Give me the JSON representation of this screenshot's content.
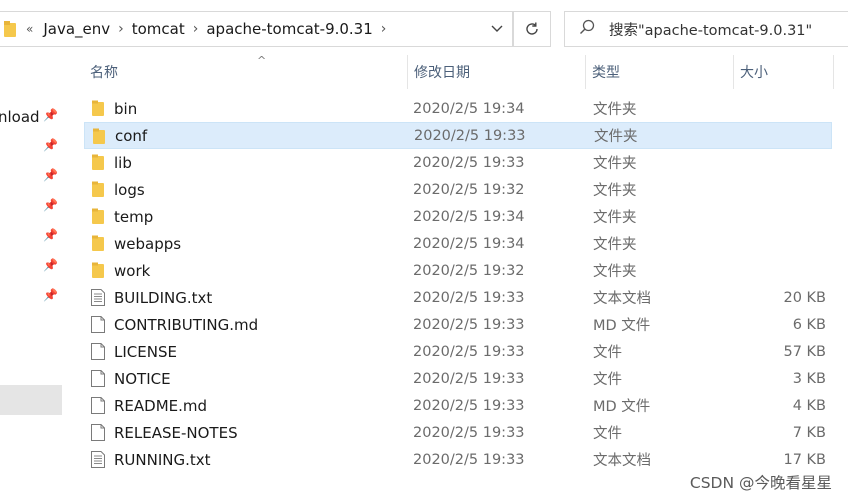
{
  "address": {
    "overflow": "«",
    "crumbs": [
      "Java_env",
      "tomcat",
      "apache-tomcat-9.0.31"
    ]
  },
  "search": {
    "placeholder": "搜索\"apache-tomcat-9.0.31\""
  },
  "nav": {
    "items": [
      {
        "label": "nload"
      },
      {
        "label": ""
      },
      {
        "label": ""
      },
      {
        "label": ""
      },
      {
        "label": ""
      },
      {
        "label": ""
      },
      {
        "label": ""
      }
    ]
  },
  "columns": {
    "name": "名称",
    "date": "修改日期",
    "type": "类型",
    "size": "大小"
  },
  "files": [
    {
      "name": "bin",
      "date": "2020/2/5 19:34",
      "type": "文件夹",
      "size": "",
      "icon": "folder-icon"
    },
    {
      "name": "conf",
      "date": "2020/2/5 19:33",
      "type": "文件夹",
      "size": "",
      "icon": "folder-icon",
      "selected": true
    },
    {
      "name": "lib",
      "date": "2020/2/5 19:33",
      "type": "文件夹",
      "size": "",
      "icon": "folder-icon"
    },
    {
      "name": "logs",
      "date": "2020/2/5 19:32",
      "type": "文件夹",
      "size": "",
      "icon": "folder-icon"
    },
    {
      "name": "temp",
      "date": "2020/2/5 19:34",
      "type": "文件夹",
      "size": "",
      "icon": "folder-icon"
    },
    {
      "name": "webapps",
      "date": "2020/2/5 19:34",
      "type": "文件夹",
      "size": "",
      "icon": "folder-icon"
    },
    {
      "name": "work",
      "date": "2020/2/5 19:32",
      "type": "文件夹",
      "size": "",
      "icon": "folder-icon"
    },
    {
      "name": "BUILDING.txt",
      "date": "2020/2/5 19:33",
      "type": "文本文档",
      "size": "20 KB",
      "icon": "text-file-icon"
    },
    {
      "name": "CONTRIBUTING.md",
      "date": "2020/2/5 19:33",
      "type": "MD 文件",
      "size": "6 KB",
      "icon": "file-icon"
    },
    {
      "name": "LICENSE",
      "date": "2020/2/5 19:33",
      "type": "文件",
      "size": "57 KB",
      "icon": "file-icon"
    },
    {
      "name": "NOTICE",
      "date": "2020/2/5 19:33",
      "type": "文件",
      "size": "3 KB",
      "icon": "file-icon"
    },
    {
      "name": "README.md",
      "date": "2020/2/5 19:33",
      "type": "MD 文件",
      "size": "4 KB",
      "icon": "file-icon"
    },
    {
      "name": "RELEASE-NOTES",
      "date": "2020/2/5 19:33",
      "type": "文件",
      "size": "7 KB",
      "icon": "file-icon"
    },
    {
      "name": "RUNNING.txt",
      "date": "2020/2/5 19:33",
      "type": "文本文档",
      "size": "17 KB",
      "icon": "text-file-icon"
    }
  ],
  "watermark": "CSDN @今晚看星星",
  "colors": {
    "folder": "#f5c84c",
    "selection": "#dcecfb",
    "header_text": "#4c607a"
  }
}
